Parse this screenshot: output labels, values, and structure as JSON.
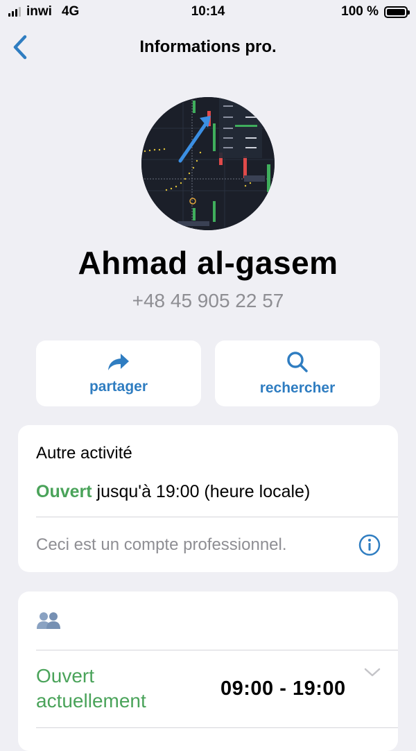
{
  "status_bar": {
    "carrier": "inwi",
    "network": "4G",
    "time": "10:14",
    "battery": "100 %"
  },
  "nav": {
    "title": "Informations pro."
  },
  "profile": {
    "name": "Ahmad al-gasem",
    "phone": "+48 45 905 22 57"
  },
  "actions": {
    "share_label": "partager",
    "search_label": "rechercher"
  },
  "activity_card": {
    "title": "Autre activité",
    "open_status": "Ouvert",
    "hours_text": " jusqu'à 19:00 (heure locale)",
    "note": "Ceci est un compte professionnel."
  },
  "hours_card": {
    "open_now": "Ouvert actuellement",
    "range": "09:00 - 19:00"
  },
  "colors": {
    "accent": "#2f7dc1",
    "open_green": "#4aa35a",
    "secondary_text": "#8e8e93",
    "background": "#efeff4"
  },
  "icons": {
    "back": "chevron-left-icon",
    "share": "share-arrow-icon",
    "search": "search-icon",
    "info": "info-icon",
    "people": "people-icon",
    "expand": "chevron-down-icon"
  }
}
